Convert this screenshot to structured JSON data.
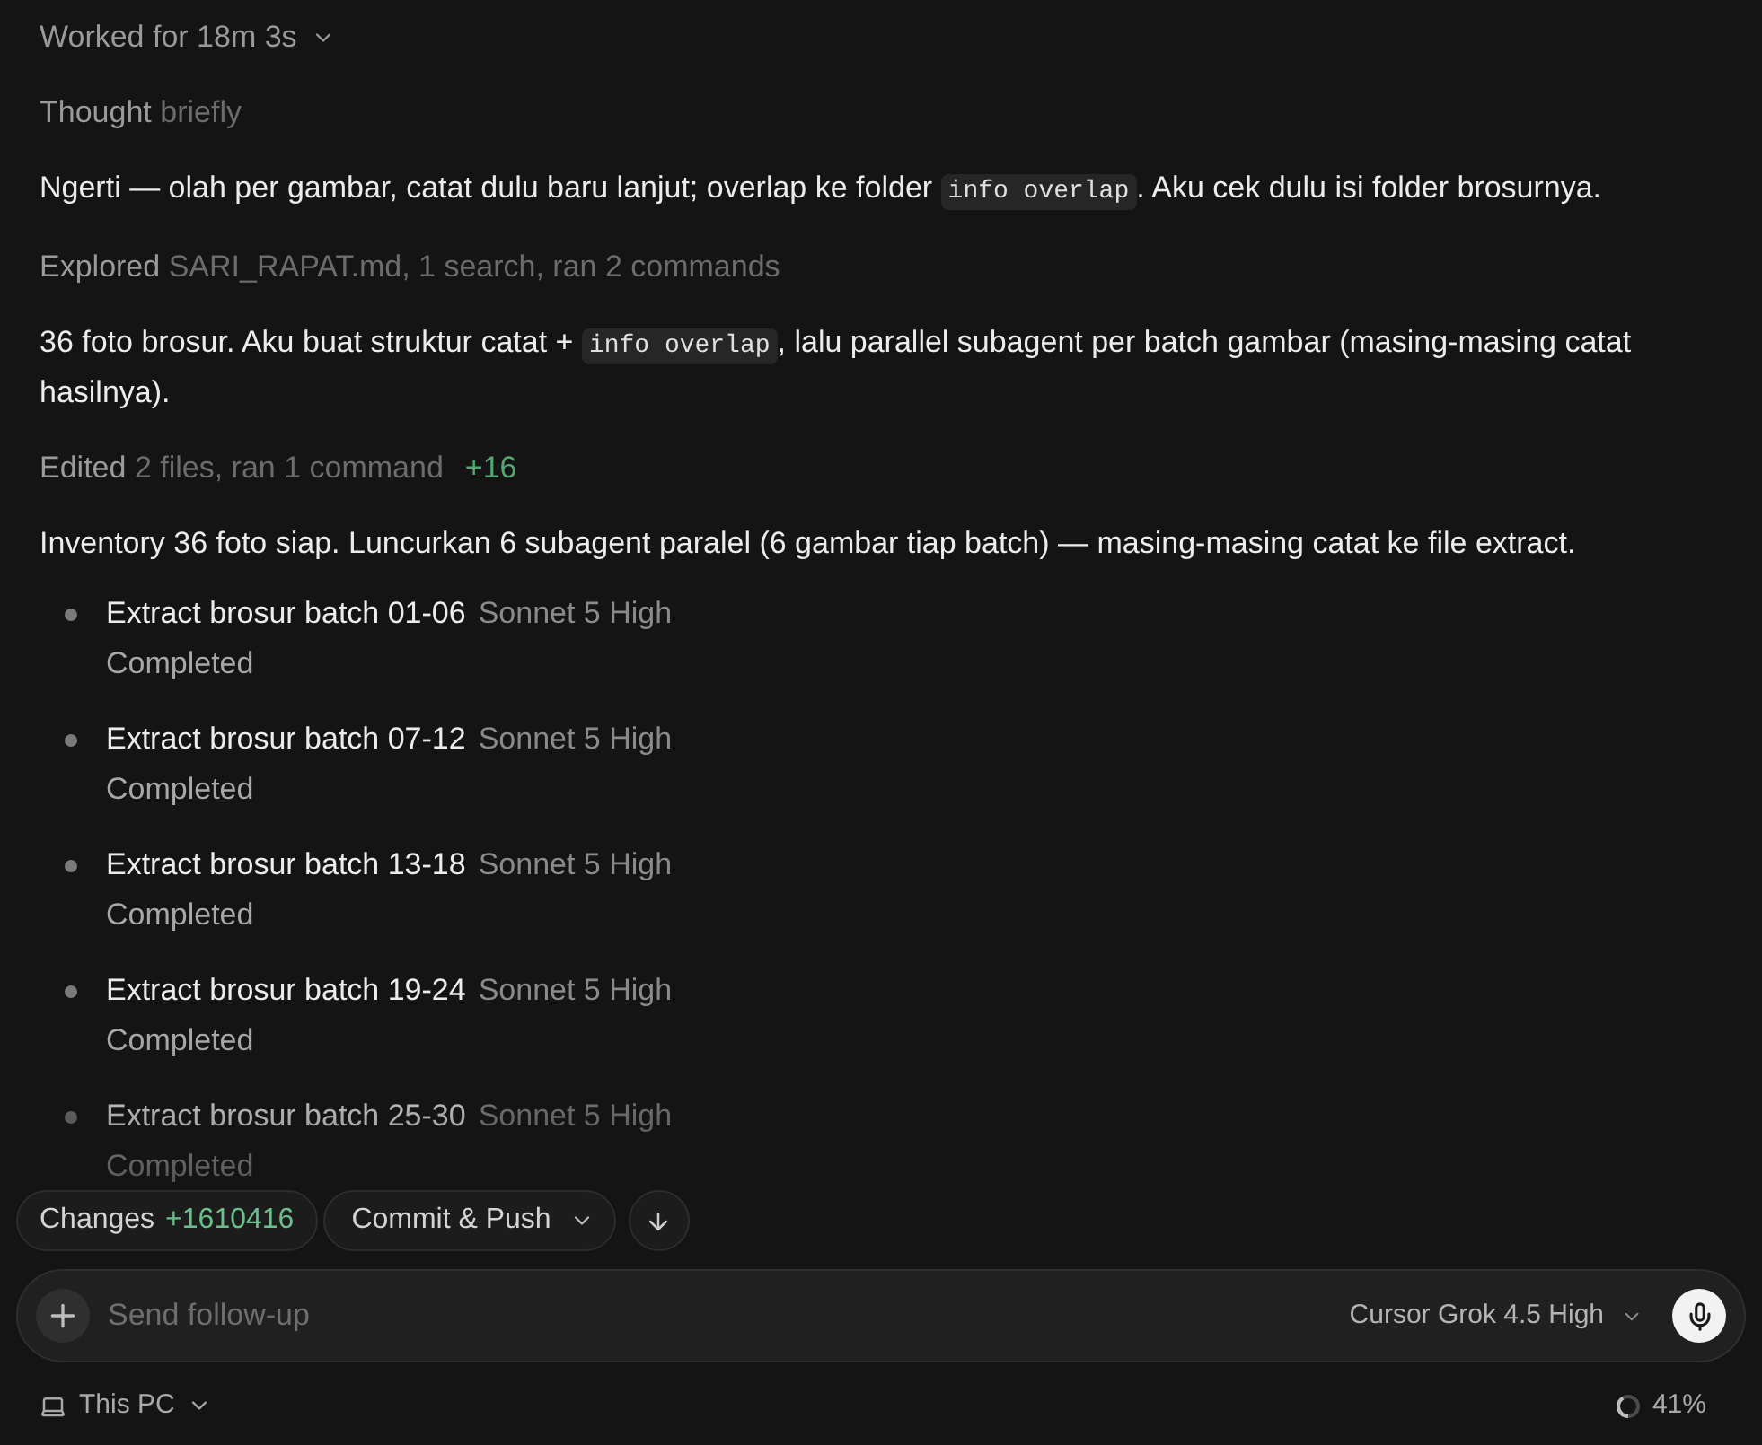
{
  "header": {
    "label": "Worked for 18m 3s",
    "expanded": false
  },
  "transcript": [
    {
      "kind": "activity",
      "verb": "Thought",
      "detail": "briefly"
    },
    {
      "kind": "message",
      "parts": [
        {
          "kind": "text",
          "text": "Ngerti — olah per gambar, catat dulu baru lanjut; overlap ke folder "
        },
        {
          "kind": "code",
          "text": "info overlap"
        },
        {
          "kind": "text",
          "text": ". Aku cek dulu isi folder brosurnya."
        }
      ]
    },
    {
      "kind": "activity",
      "verb": "Explored",
      "detail": "SARI_RAPAT.md, 1 search, ran 2 commands"
    },
    {
      "kind": "message",
      "parts": [
        {
          "kind": "text",
          "text": "36 foto brosur. Aku buat struktur catat + "
        },
        {
          "kind": "code",
          "text": "info overlap"
        },
        {
          "kind": "text",
          "text": ", lalu parallel subagent per batch gambar (masing-masing catat hasilnya)."
        }
      ]
    },
    {
      "kind": "activity",
      "verb": "Edited",
      "detail": "2 files, ran 1 command",
      "added": "+16"
    },
    {
      "kind": "message",
      "parts": [
        {
          "kind": "text",
          "text": "Inventory 36 foto siap. Luncurkan 6 subagent paralel (6 gambar tiap batch) — masing-masing catat ke file extract."
        }
      ]
    },
    {
      "kind": "tasks",
      "items": [
        {
          "title": "Extract brosur batch 01-06",
          "model": "Sonnet 5 High",
          "status": "Completed"
        },
        {
          "title": "Extract brosur batch 07-12",
          "model": "Sonnet 5 High",
          "status": "Completed"
        },
        {
          "title": "Extract brosur batch 13-18",
          "model": "Sonnet 5 High",
          "status": "Completed"
        },
        {
          "title": "Extract brosur batch 19-24",
          "model": "Sonnet 5 High",
          "status": "Completed"
        },
        {
          "title": "Extract brosur batch 25-30",
          "model": "Sonnet 5 High",
          "status": "Completed"
        }
      ]
    }
  ],
  "toolbar": {
    "changes": {
      "label": "Changes",
      "count": "+1610416"
    },
    "commit": {
      "label": "Commit & Push"
    }
  },
  "composer": {
    "placeholder": "Send follow-up",
    "model": "Cursor Grok 4.5 High"
  },
  "footer": {
    "location": "This PC",
    "context": {
      "level": 0.41,
      "reading": "41%"
    }
  }
}
